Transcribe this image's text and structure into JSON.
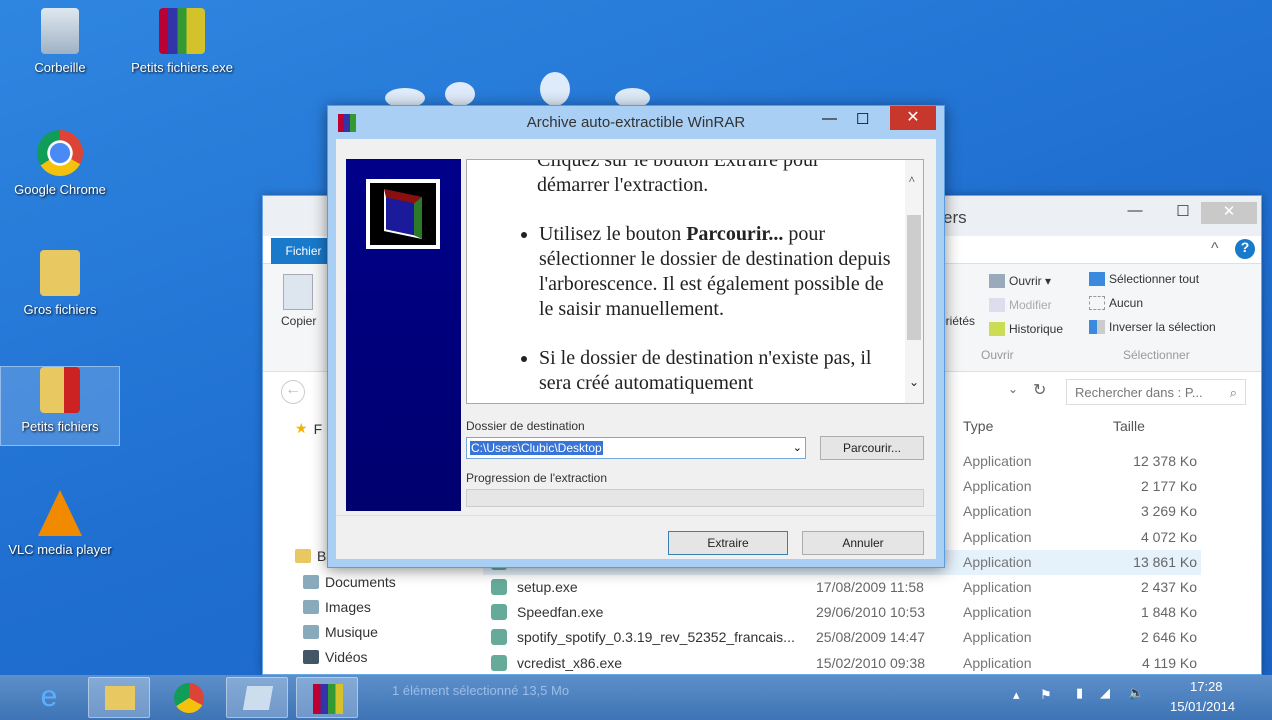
{
  "desktop": {
    "icons": [
      {
        "label": "Corbeille"
      },
      {
        "label": "Petits fichiers.exe"
      },
      {
        "label": "Google Chrome"
      },
      {
        "label": "Gros fichiers"
      },
      {
        "label": "Petits fichiers"
      },
      {
        "label": "VLC media player"
      }
    ]
  },
  "explorer": {
    "title_fragment": "ers",
    "tab_file": "Fichier",
    "copy": "Copier",
    "properties": "priétés",
    "open": "Ouvrir ▾",
    "modify": "Modifier",
    "history": "Historique",
    "group_open": "Ouvrir",
    "select_all": "Sélectionner tout",
    "none": "Aucun",
    "invert": "Inverser la sélection",
    "group_select": "Sélectionner",
    "search_placeholder": "Rechercher dans : P...",
    "nav": {
      "favorites": "F",
      "libraries": "B",
      "items": [
        "Documents",
        "Images",
        "Musique",
        "Vidéos"
      ]
    },
    "columns": {
      "type": "Type",
      "size": "Taille"
    },
    "rows": [
      {
        "name": "",
        "date": "",
        "type": "Application",
        "size": "12 378 Ko"
      },
      {
        "name": "",
        "date": "",
        "type": "Application",
        "size": "2 177 Ko"
      },
      {
        "name": "",
        "date": "",
        "type": "Application",
        "size": "3 269 Ko"
      },
      {
        "name": "",
        "date": "",
        "type": "Application",
        "size": "4 072 Ko"
      },
      {
        "name": "",
        "date": "",
        "type": "Application",
        "size": "13 861 Ko",
        "selected": true
      },
      {
        "name": "setup.exe",
        "date": "17/08/2009 11:58",
        "type": "Application",
        "size": "2 437 Ko"
      },
      {
        "name": "Speedfan.exe",
        "date": "29/06/2010 10:53",
        "type": "Application",
        "size": "1 848 Ko"
      },
      {
        "name": "spotify_spotify_0.3.19_rev_52352_francais...",
        "date": "25/08/2009 14:47",
        "type": "Application",
        "size": "2 646 Ko"
      },
      {
        "name": "vcredist_x86.exe",
        "date": "15/02/2010 09:38",
        "type": "Application",
        "size": "4 119 Ko"
      }
    ],
    "status": "1 élément sélectionné  13,5 Mo"
  },
  "winrar": {
    "title": "Archive auto-extractible WinRAR",
    "text": {
      "clipped_line": "Cliquez sur le bouton Extraire pour",
      "line1": "démarrer l'extraction.",
      "b1_pre": "Utilisez le bouton ",
      "b1_bold": "Parcourir...",
      "b1_post": " pour sélectionner le dossier de destination depuis l'arborescence. Il est également possible de le saisir manuellement.",
      "b2": "Si le dossier de destination n'existe pas, il sera créé automatiquement"
    },
    "dest_label": "Dossier de destination",
    "dest_value": "C:\\Users\\Clubic\\Desktop",
    "browse": "Parcourir...",
    "progress_label": "Progression de l'extraction",
    "progress": 0,
    "extract": "Extraire",
    "cancel": "Annuler"
  },
  "taskbar": {
    "time": "17:28",
    "date": "15/01/2014"
  }
}
